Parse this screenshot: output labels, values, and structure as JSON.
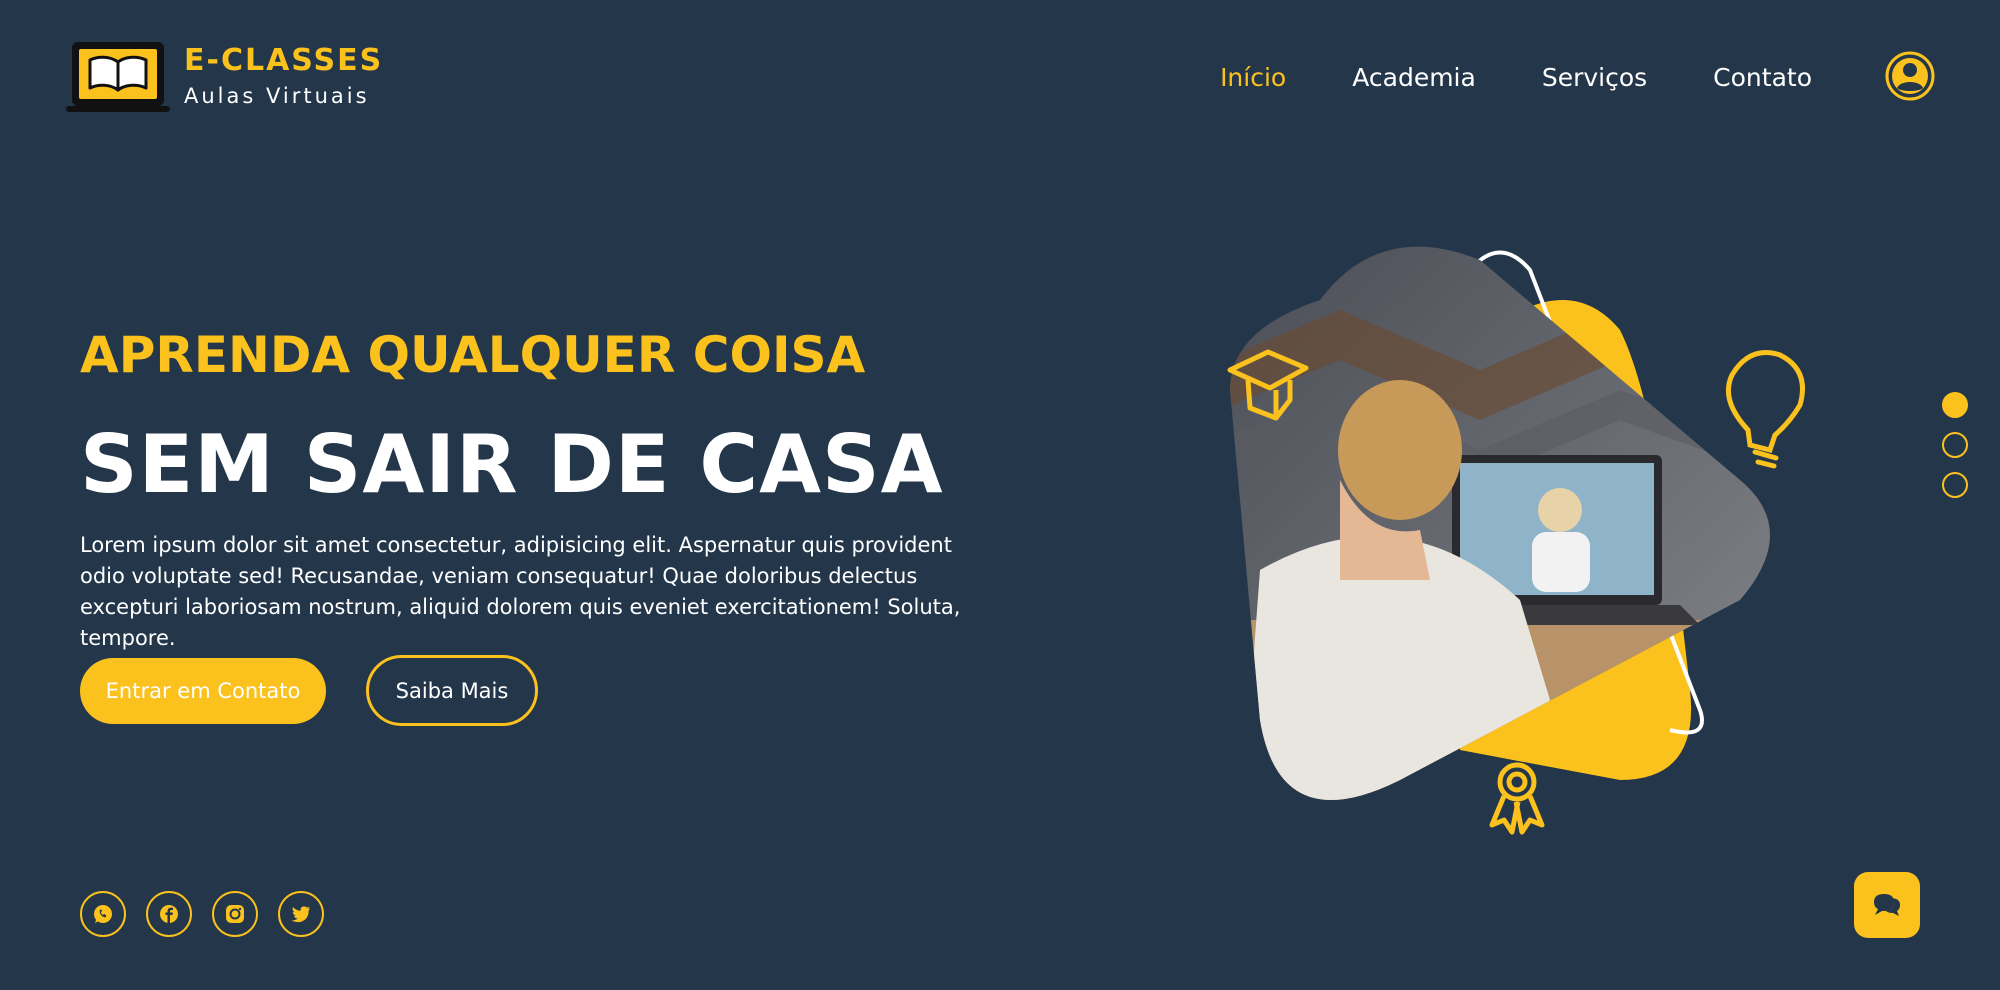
{
  "brand": {
    "title": "E-CLASSES",
    "subtitle": "Aulas Virtuais"
  },
  "nav": {
    "items": [
      {
        "label": "Início",
        "active": true
      },
      {
        "label": "Academia",
        "active": false
      },
      {
        "label": "Serviços",
        "active": false
      },
      {
        "label": "Contato",
        "active": false
      }
    ]
  },
  "hero": {
    "eyebrow": "APRENDA QUALQUER COISA",
    "headline": "SEM SAIR DE CASA",
    "description": "Lorem ipsum dolor sit amet consectetur, adipisicing elit. Aspernatur quis provident odio voluptate sed! Recusandae, veniam consequatur! Quae doloribus delectus excepturi laboriosam nostrum, aliquid dolorem quis eveniet exercitationem! Soluta, tempore.",
    "primary_button": "Entrar em Contato",
    "secondary_button": "Saiba Mais"
  },
  "social": [
    "whatsapp-icon",
    "facebook-icon",
    "instagram-icon",
    "twitter-icon"
  ],
  "slider": {
    "count": 3,
    "active_index": 0
  },
  "colors": {
    "background": "#23364a",
    "accent": "#fbc21d",
    "text": "#ffffff"
  }
}
